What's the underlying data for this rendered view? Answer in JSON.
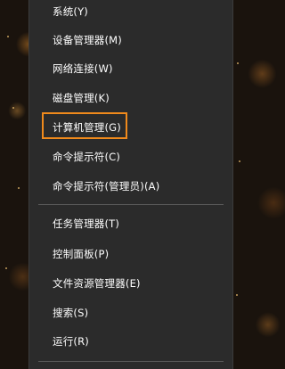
{
  "context_menu": {
    "group1": [
      "系统(Y)",
      "设备管理器(M)",
      "网络连接(W)",
      "磁盘管理(K)",
      "计算机管理(G)",
      "命令提示符(C)",
      "命令提示符(管理员)(A)"
    ],
    "group2": [
      "任务管理器(T)",
      "控制面板(P)",
      "文件资源管理器(E)",
      "搜索(S)",
      "运行(R)"
    ],
    "highlighted_item": "计算机管理(G)",
    "highlight_color": "#f08a1c"
  }
}
